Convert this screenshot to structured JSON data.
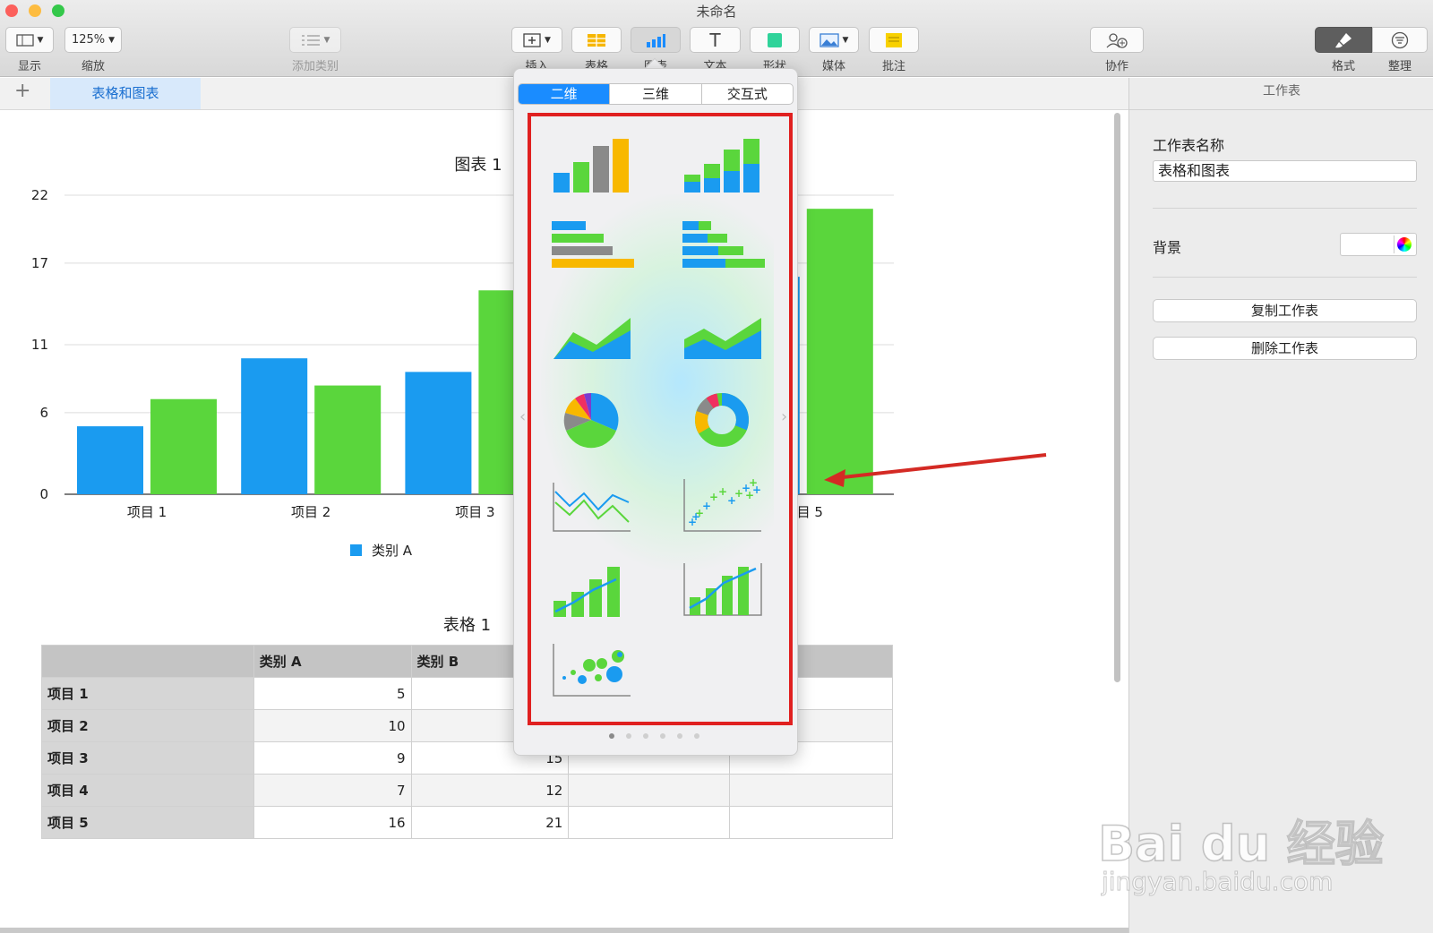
{
  "window": {
    "title": "未命名"
  },
  "toolbar": {
    "view_label": "显示",
    "zoom_value": "125%",
    "zoom_label": "缩放",
    "add_category_label": "添加类别",
    "insert_label": "插入",
    "table_label": "表格",
    "chart_label": "图表",
    "text_label": "文本",
    "shape_label": "形状",
    "media_label": "媒体",
    "comment_label": "批注",
    "collab_label": "协作",
    "format_label": "格式",
    "organize_label": "整理"
  },
  "tabs": {
    "add": "+",
    "sheet_tab": "表格和图表"
  },
  "popover": {
    "segments": [
      "二维",
      "三维",
      "交互式"
    ],
    "selected_segment": "二维",
    "chart_types": [
      "column",
      "stacked-column",
      "bar",
      "stacked-bar",
      "area",
      "stacked-area",
      "pie",
      "donut",
      "line",
      "scatter",
      "mixed",
      "two-axis",
      "bubble"
    ],
    "page_count": 6,
    "current_page": 1
  },
  "sidebar": {
    "header": "工作表",
    "name_label": "工作表名称",
    "name_value": "表格和图表",
    "background_label": "背景",
    "duplicate_button": "复制工作表",
    "delete_button": "删除工作表"
  },
  "chart_data": {
    "type": "bar",
    "title": "图表 1",
    "categories": [
      "项目 1",
      "项目 2",
      "项目 3",
      "项目 4",
      "项目 5"
    ],
    "series": [
      {
        "name": "类别 A",
        "values": [
          5,
          10,
          9,
          7,
          16
        ],
        "color": "#1a9bf0"
      },
      {
        "name": "类别 B",
        "values": [
          7,
          8,
          15,
          12,
          21
        ],
        "color": "#5ad63c"
      }
    ],
    "yticks": [
      "0",
      "6",
      "11",
      "17",
      "22"
    ],
    "ylim": [
      0,
      22
    ],
    "legend_visible": [
      "类别 A"
    ],
    "grid": true
  },
  "table": {
    "title": "表格 1",
    "headers": [
      "",
      "类别 A",
      "类别 B",
      "",
      ""
    ],
    "rows": [
      {
        "label": "项目 1",
        "a": "5",
        "b": ""
      },
      {
        "label": "项目 2",
        "a": "10",
        "b": ""
      },
      {
        "label": "项目 3",
        "a": "9",
        "b": "15"
      },
      {
        "label": "项目 4",
        "a": "7",
        "b": "12"
      },
      {
        "label": "项目 5",
        "a": "16",
        "b": "21"
      }
    ]
  },
  "watermark": {
    "brand": "Bai du 经验",
    "url": "jingyan.baidu.com"
  },
  "colors": {
    "accent": "#1a8cff",
    "highlight": "#e02020",
    "series_a": "#1a9bf0",
    "series_b": "#5ad63c"
  }
}
